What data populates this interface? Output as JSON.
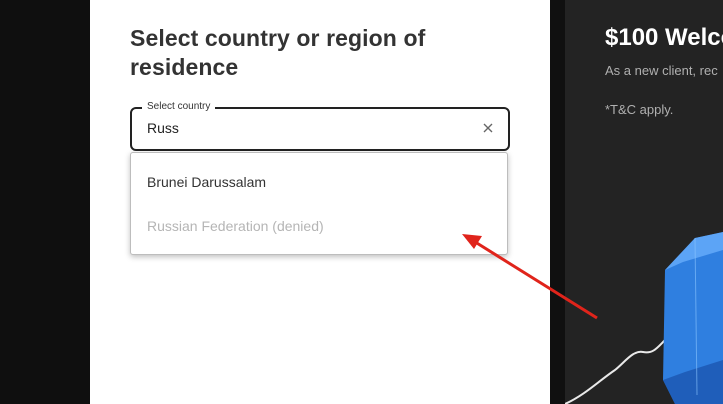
{
  "form": {
    "title": "Select country or region of residence",
    "field_label": "Select country",
    "search_value": "Russ",
    "clear_icon": "close-icon"
  },
  "dropdown": {
    "options": [
      {
        "label": "Brunei Darussalam",
        "state": "enabled"
      },
      {
        "label": "Russian Federation (denied)",
        "state": "disabled"
      }
    ]
  },
  "promo": {
    "title": "$100 Welco",
    "subtitle": "As a new client, rec",
    "terms": "*T&C apply."
  },
  "colors": {
    "panel_background": "#ffffff",
    "page_background": "#101010",
    "promo_background": "#232323",
    "arrow": "#e0241b",
    "cube_blue": "#2f7fe0"
  },
  "icons": [
    "close-icon",
    "red-arrow-annotation",
    "blue-cube-graphic"
  ]
}
